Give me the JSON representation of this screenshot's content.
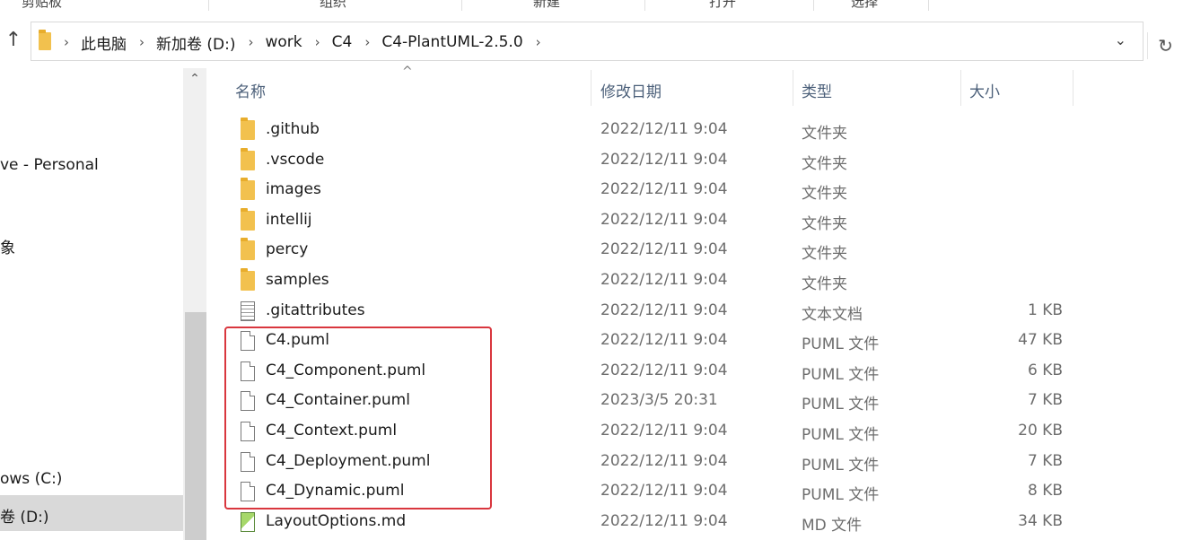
{
  "ribbon": {
    "items": [
      "剪贴板",
      "组织",
      "新建",
      "打开",
      "选择"
    ]
  },
  "address": {
    "crumbs": [
      "此电脑",
      "新加卷 (D:)",
      "work",
      "C4",
      "C4-PlantUML-2.5.0"
    ]
  },
  "nav": {
    "items": [
      {
        "label": "ve - Personal"
      },
      {
        "label": "象"
      },
      {
        "label": "ows (C:)"
      },
      {
        "label": "卷 (D:)",
        "selected": true
      }
    ]
  },
  "columns": {
    "name": "名称",
    "date": "修改日期",
    "type": "类型",
    "size": "大小"
  },
  "files": [
    {
      "name": ".github",
      "date": "2022/12/11 9:04",
      "type": "文件夹",
      "size": "",
      "icon": "folder-icon"
    },
    {
      "name": ".vscode",
      "date": "2022/12/11 9:04",
      "type": "文件夹",
      "size": "",
      "icon": "folder-icon"
    },
    {
      "name": "images",
      "date": "2022/12/11 9:04",
      "type": "文件夹",
      "size": "",
      "icon": "folder-icon"
    },
    {
      "name": "intellij",
      "date": "2022/12/11 9:04",
      "type": "文件夹",
      "size": "",
      "icon": "folder-icon"
    },
    {
      "name": "percy",
      "date": "2022/12/11 9:04",
      "type": "文件夹",
      "size": "",
      "icon": "folder-icon"
    },
    {
      "name": "samples",
      "date": "2022/12/11 9:04",
      "type": "文件夹",
      "size": "",
      "icon": "folder-icon"
    },
    {
      "name": ".gitattributes",
      "date": "2022/12/11 9:04",
      "type": "文本文档",
      "size": "1 KB",
      "icon": "text-file-icon"
    },
    {
      "name": "C4.puml",
      "date": "2022/12/11 9:04",
      "type": "PUML 文件",
      "size": "47 KB",
      "icon": "file-icon"
    },
    {
      "name": "C4_Component.puml",
      "date": "2022/12/11 9:04",
      "type": "PUML 文件",
      "size": "6 KB",
      "icon": "file-icon"
    },
    {
      "name": "C4_Container.puml",
      "date": "2023/3/5 20:31",
      "type": "PUML 文件",
      "size": "7 KB",
      "icon": "file-icon"
    },
    {
      "name": "C4_Context.puml",
      "date": "2022/12/11 9:04",
      "type": "PUML 文件",
      "size": "20 KB",
      "icon": "file-icon"
    },
    {
      "name": "C4_Deployment.puml",
      "date": "2022/12/11 9:04",
      "type": "PUML 文件",
      "size": "7 KB",
      "icon": "file-icon"
    },
    {
      "name": "C4_Dynamic.puml",
      "date": "2022/12/11 9:04",
      "type": "PUML 文件",
      "size": "8 KB",
      "icon": "file-icon"
    },
    {
      "name": "LayoutOptions.md",
      "date": "2022/12/11 9:04",
      "type": "MD 文件",
      "size": "34 KB",
      "icon": "markdown-file-icon"
    }
  ],
  "colors": {
    "highlight": "#d9363e",
    "folder": "#f2c14e",
    "header_text": "#4c607a",
    "nav_selected": "#d9d9d9"
  }
}
